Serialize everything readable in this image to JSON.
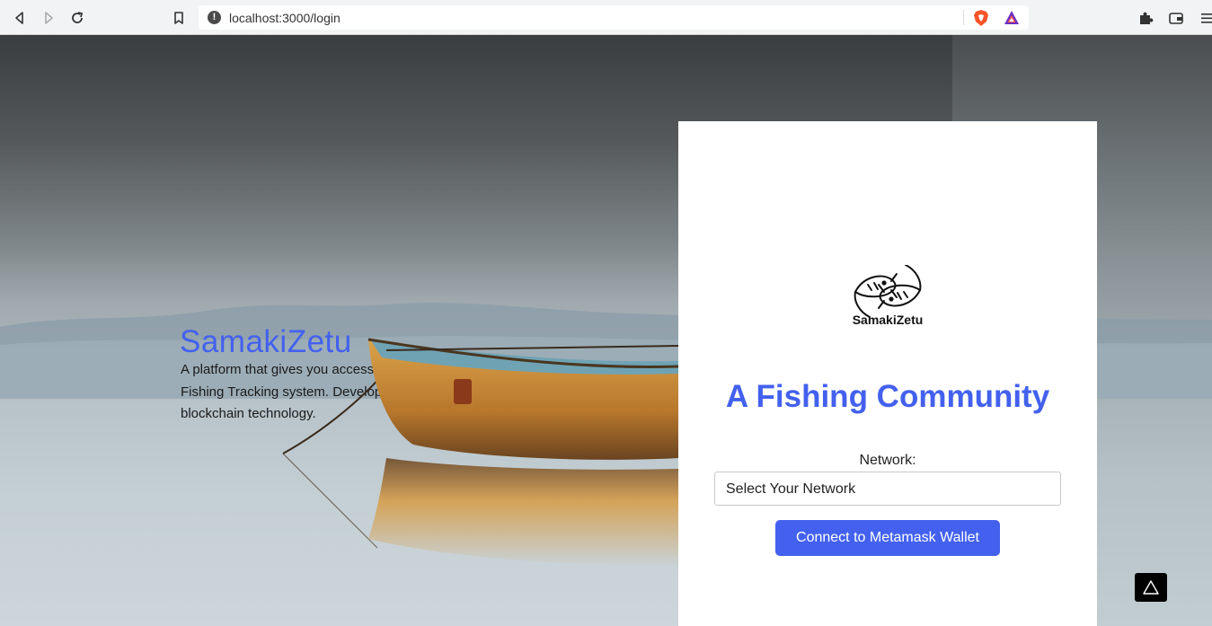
{
  "browser": {
    "url": "localhost:3000/login",
    "icons": [
      "back-icon",
      "forward-icon",
      "reload-icon",
      "bookmark-icon",
      "site-info-icon",
      "brave-shields-icon",
      "brave-rewards-icon",
      "extensions-icon",
      "wallet-icon",
      "menu-icon"
    ]
  },
  "hero": {
    "title": "SamakiZetu",
    "description": "A platform that gives you access to a secure Fishing Tracking system. Developed using blockchain technology."
  },
  "login": {
    "logo_name": "SamakiZetu",
    "headline": "A Fishing Community",
    "network_label": "Network:",
    "network_value": "Select Your Network",
    "connect_label": "Connect to Metamask Wallet"
  },
  "colors": {
    "accent": "#4361ee"
  }
}
